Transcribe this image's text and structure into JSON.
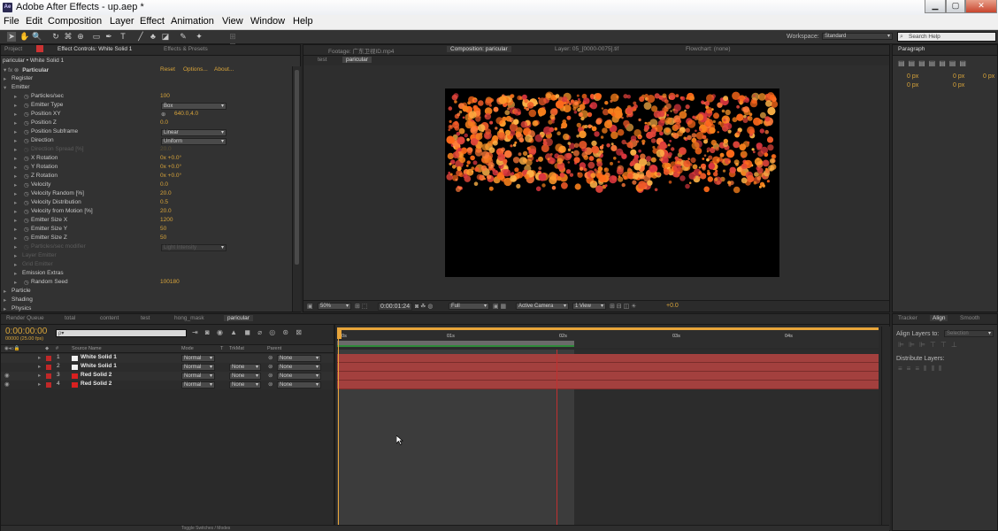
{
  "window": {
    "icon": "Ae",
    "title": "Adobe After Effects - up.aep *",
    "buttons": [
      "minimize-icon",
      "maximize-icon",
      "close-icon"
    ]
  },
  "menu": [
    "File",
    "Edit",
    "Composition",
    "Layer",
    "Effect",
    "Animation",
    "View",
    "Window",
    "Help"
  ],
  "toolbar": {
    "workspace_label": "Workspace:",
    "workspace_value": "Standard",
    "search_placeholder": "Search Help"
  },
  "left_panel": {
    "tabs": [
      "Project",
      "Effect Controls: White Solid 1",
      "Effects & Presets"
    ],
    "breadcrumb": "paricular • White Solid 1",
    "effect": {
      "name": "Particular",
      "reset": "Reset",
      "options": "Options...",
      "about": "About..."
    },
    "rows": [
      {
        "label": "Register",
        "value": "",
        "kind": "group",
        "indent": 1,
        "dim": false
      },
      {
        "label": "Emitter",
        "value": "",
        "kind": "group-open",
        "indent": 1,
        "dim": false
      },
      {
        "label": "Particles/sec",
        "value": "100",
        "kind": "val",
        "indent": 2,
        "dim": false
      },
      {
        "label": "Emitter Type",
        "value": "Box",
        "kind": "dd",
        "indent": 2,
        "dim": false
      },
      {
        "label": "Position XY",
        "value": "640.0,4.0",
        "kind": "pt",
        "indent": 2,
        "dim": false
      },
      {
        "label": "Position Z",
        "value": "0.0",
        "kind": "val",
        "indent": 2,
        "dim": false
      },
      {
        "label": "Position Subframe",
        "value": "Linear",
        "kind": "dd",
        "indent": 2,
        "dim": false
      },
      {
        "label": "Direction",
        "value": "Uniform",
        "kind": "dd",
        "indent": 2,
        "dim": false
      },
      {
        "label": "Direction Spread [%]",
        "value": "20.0",
        "kind": "val",
        "indent": 2,
        "dim": true
      },
      {
        "label": "X Rotation",
        "value": "0x +0.0°",
        "kind": "val",
        "indent": 2,
        "dim": false
      },
      {
        "label": "Y Rotation",
        "value": "0x +0.0°",
        "kind": "val",
        "indent": 2,
        "dim": false
      },
      {
        "label": "Z Rotation",
        "value": "0x +0.0°",
        "kind": "val",
        "indent": 2,
        "dim": false
      },
      {
        "label": "Velocity",
        "value": "0.0",
        "kind": "val",
        "indent": 2,
        "dim": false
      },
      {
        "label": "Velocity Random [%]",
        "value": "20.0",
        "kind": "val",
        "indent": 2,
        "dim": false
      },
      {
        "label": "Velocity Distribution",
        "value": "0.5",
        "kind": "val",
        "indent": 2,
        "dim": false
      },
      {
        "label": "Velocity from Motion [%]",
        "value": "20.0",
        "kind": "val",
        "indent": 2,
        "dim": false
      },
      {
        "label": "Emitter Size X",
        "value": "1200",
        "kind": "val",
        "indent": 2,
        "dim": false
      },
      {
        "label": "Emitter Size Y",
        "value": "50",
        "kind": "val",
        "indent": 2,
        "dim": false
      },
      {
        "label": "Emitter Size Z",
        "value": "50",
        "kind": "val",
        "indent": 2,
        "dim": false
      },
      {
        "label": "Particles/sec modifier",
        "value": "Light Intensity",
        "kind": "dd",
        "indent": 2,
        "dim": true
      },
      {
        "label": "Layer Emitter",
        "value": "",
        "kind": "group",
        "indent": 2,
        "dim": true
      },
      {
        "label": "Grid Emitter",
        "value": "",
        "kind": "group",
        "indent": 2,
        "dim": true
      },
      {
        "label": "Emission Extras",
        "value": "",
        "kind": "group",
        "indent": 2,
        "dim": false
      },
      {
        "label": "Random Seed",
        "value": "100180",
        "kind": "val",
        "indent": 2,
        "dim": false
      },
      {
        "label": "Particle",
        "value": "",
        "kind": "group",
        "indent": 1,
        "dim": false
      },
      {
        "label": "Shading",
        "value": "",
        "kind": "group",
        "indent": 1,
        "dim": false
      },
      {
        "label": "Physics",
        "value": "",
        "kind": "group",
        "indent": 1,
        "dim": false
      }
    ]
  },
  "viewer": {
    "tabs": [
      "Footage: 广东卫视ID.mp4",
      "Composition: paricular",
      "Layer: 05_[0000-0075].tif",
      "Flowchart: (none)"
    ],
    "subtabs": [
      "test",
      "paricular"
    ],
    "zoom": "50%",
    "timecode": "0:00:01:24",
    "resolution": "Full",
    "camera": "Active Camera",
    "views": "1 View",
    "exposure": "+0.0"
  },
  "timeline": {
    "tabs": [
      "Render Queue",
      "total",
      "content",
      "test",
      "hong_mask",
      "paricular"
    ],
    "timecode": "0:00:00:00",
    "fps": "00000 (25.00 fps)",
    "search_placeholder": "ρ▾",
    "columns": [
      "#",
      "Source Name",
      "Mode",
      "T",
      "TrkMat",
      "Parent"
    ],
    "ruler": [
      "00s",
      "01s",
      "02s",
      "03s",
      "04s"
    ],
    "layers": [
      {
        "num": "1",
        "name": "White Solid 1",
        "color": "#f2f2f2",
        "mode": "Normal",
        "trkmat": "",
        "parent": "None",
        "bar": "#a3403e"
      },
      {
        "num": "2",
        "name": "White Solid 1",
        "color": "#f2f2f2",
        "mode": "Normal",
        "trkmat": "None",
        "parent": "None",
        "bar": "#a3403e"
      },
      {
        "num": "3",
        "name": "Red Solid 2",
        "color": "#d92020",
        "mode": "Normal",
        "trkmat": "None",
        "parent": "None",
        "bar": "#a3403e"
      },
      {
        "num": "4",
        "name": "Red Solid 2",
        "color": "#d92020",
        "mode": "Normal",
        "trkmat": "None",
        "parent": "None",
        "bar": "#a3403e"
      }
    ],
    "bottom": [
      "Toggle Switches / Modes"
    ]
  },
  "paragraph": {
    "tab": "Paragraph",
    "fields": [
      "0 px",
      "0 px",
      "0 px",
      "0 px",
      "0 px"
    ]
  },
  "align": {
    "tabs": [
      "Tracker",
      "Align",
      "Smooth"
    ],
    "align_to_label": "Align Layers to:",
    "align_to_value": "Selection",
    "distribute_label": "Distribute Layers:"
  }
}
